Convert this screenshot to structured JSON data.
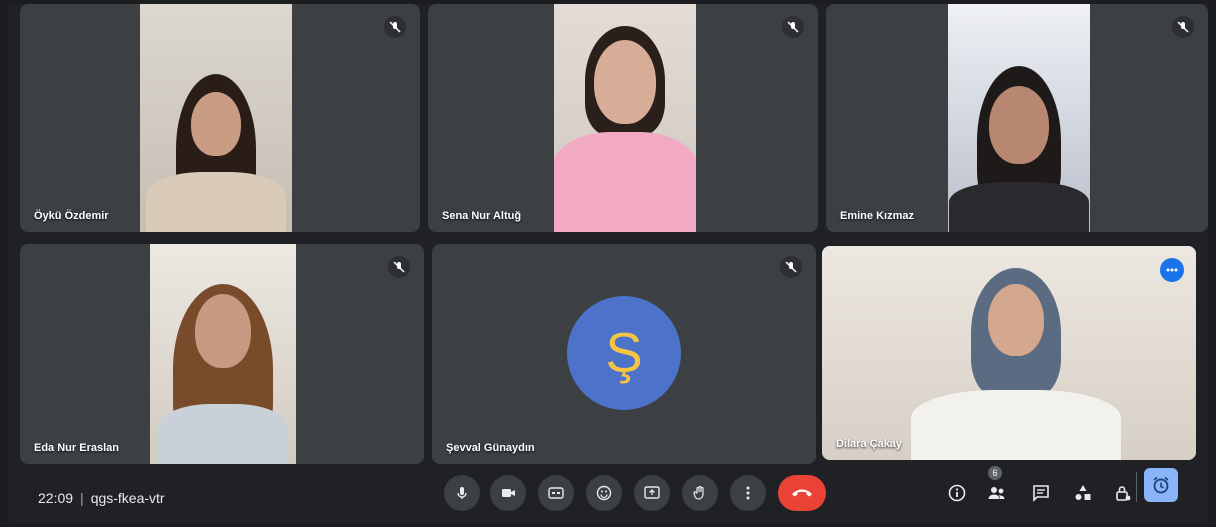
{
  "participants": [
    {
      "name": "Öykü Özdemir",
      "muted": true,
      "video": true
    },
    {
      "name": "Sena Nur Altuğ",
      "muted": true,
      "video": true
    },
    {
      "name": "Emine Kızmaz",
      "muted": true,
      "video": true
    },
    {
      "name": "Eda Nur Eraslan",
      "muted": true,
      "video": true
    },
    {
      "name": "Şevval Günaydın",
      "muted": true,
      "video": false,
      "initial": "Ş"
    },
    {
      "name": "Dilara Çakay",
      "muted": false,
      "video": true,
      "self": true
    }
  ],
  "meeting": {
    "time": "22:09",
    "separator": "|",
    "code": "qgs-fkea-vtr"
  },
  "people_count": "6",
  "controls": [
    "mic-icon",
    "camera-icon",
    "captions-icon",
    "emoji-icon",
    "present-icon",
    "raise-hand-icon",
    "more-options-icon",
    "end-call-icon"
  ],
  "right_controls": [
    "info-icon",
    "people-icon",
    "chat-icon",
    "activities-icon",
    "host-controls-icon",
    "timer-icon"
  ],
  "colors": {
    "tile": "#3c4043",
    "background": "#202124",
    "end_call": "#ea4335",
    "avatar": "#4c73c9",
    "accent": "#8ab4f8"
  }
}
